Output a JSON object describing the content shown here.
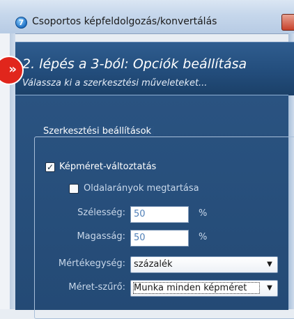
{
  "window": {
    "title": "Csoportos képfeldolgozás/konvertálás",
    "app_icon_glyph": "7"
  },
  "header": {
    "title": "2. lépés a 3-ból: Opciók beállítása",
    "subtitle": "Válassza ki a szerkesztési műveleteket..."
  },
  "group": {
    "legend": "Szerkesztési beállítások",
    "resize_checkbox": {
      "label": "Képméret-változtatás",
      "checked": true
    },
    "aspect_checkbox": {
      "label": "Oldalarányok megtartása",
      "checked": false
    },
    "width": {
      "label": "Szélesség:",
      "value": "50",
      "unit": "%"
    },
    "height": {
      "label": "Magasság:",
      "value": "50",
      "unit": "%"
    },
    "unit_select": {
      "label": "Mértékegység:",
      "value": "százalék"
    },
    "filter_select": {
      "label": "Méret-szűrő:",
      "value": "Munka minden képméret"
    }
  },
  "colors": {
    "banner": "#234d7c",
    "content": "#2a5381",
    "step_marker": "#e1261c"
  }
}
